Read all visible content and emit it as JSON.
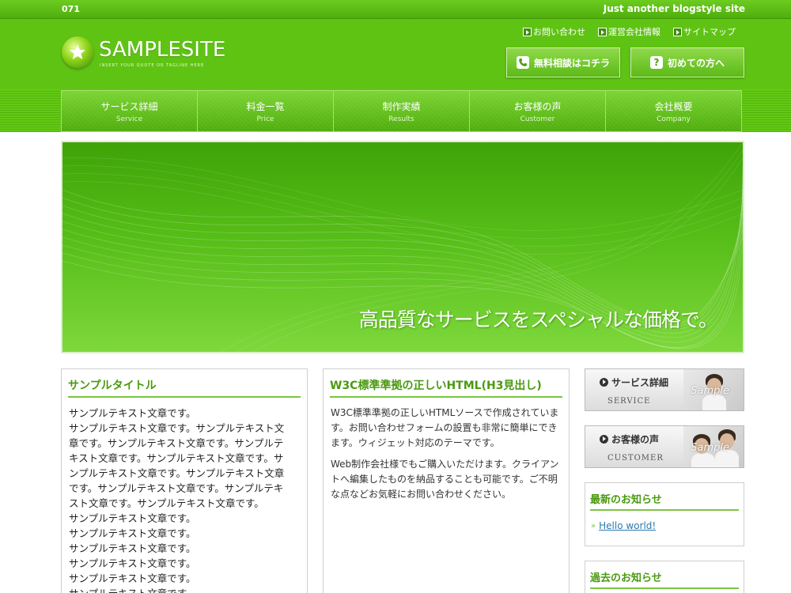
{
  "topbar": {
    "number": "071",
    "tagline": "Just another blogstyle site"
  },
  "logo": {
    "name": "SAMPLESITE",
    "tagline": "INSERT YOUR QUOTE OR TAGLINE HERE"
  },
  "toplinks": [
    {
      "label": "お問い合わせ",
      "icon": "play-square-icon"
    },
    {
      "label": "運営会社情報",
      "icon": "play-square-icon"
    },
    {
      "label": "サイトマップ",
      "icon": "play-square-icon"
    }
  ],
  "header_buttons": [
    {
      "label": "無料相談はコチラ",
      "icon": "phone-icon"
    },
    {
      "label": "初めての方へ",
      "icon": "question-icon"
    }
  ],
  "nav": [
    {
      "jp": "サービス詳細",
      "en": "Service"
    },
    {
      "jp": "料金一覧",
      "en": "Price"
    },
    {
      "jp": "制作実績",
      "en": "Results"
    },
    {
      "jp": "お客様の声",
      "en": "Customer"
    },
    {
      "jp": "会社概要",
      "en": "Company"
    }
  ],
  "hero": {
    "headline": "高品質なサービスをスペシャルな価格で。"
  },
  "col1": {
    "title": "サンプルタイトル",
    "lines": [
      "サンプルテキスト文章です。",
      "サンプルテキスト文章です。サンプルテキスト文",
      "章です。サンプルテキスト文章です。サンプルテ",
      "キスト文章です。サンプルテキスト文章です。サ",
      "ンプルテキスト文章です。サンプルテキスト文章",
      "です。サンプルテキスト文章です。サンプルテキ",
      "スト文章です。サンプルテキスト文章です。",
      "サンプルテキスト文章です。",
      "サンプルテキスト文章です。",
      "サンプルテキスト文章です。",
      "サンプルテキスト文章です。",
      "サンプルテキスト文章です。",
      "サンプルテキスト文章です。"
    ]
  },
  "col2": {
    "title": "W3C標準準拠の正しいHTML(H3見出し)",
    "paragraphs": [
      "W3C標準準拠の正しいHTMLソースで作成されています。お問い合わせフォームの設置も非常に簡単にできます。ウィジェット対応のテーマです。",
      "Web制作会社様でもご購入いただけます。クライアントへ編集したものを納品することも可能です。ご不明な点などお気軽にお問い合わせください。"
    ]
  },
  "sidebar": {
    "banners": [
      {
        "title": "サービス詳細",
        "en": "SERVICE",
        "photo_label": "Sample"
      },
      {
        "title": "お客様の声",
        "en": "CUSTOMER",
        "photo_label": "Sample"
      }
    ],
    "latest": {
      "title": "最新のお知らせ",
      "items": [
        "Hello world!"
      ]
    },
    "past": {
      "title": "過去のお知らせ"
    }
  },
  "colors": {
    "brand_green": "#5fc314",
    "title_green": "#4a9a0e",
    "rule_green": "#7cc441",
    "link_blue": "#2a7ab0"
  }
}
